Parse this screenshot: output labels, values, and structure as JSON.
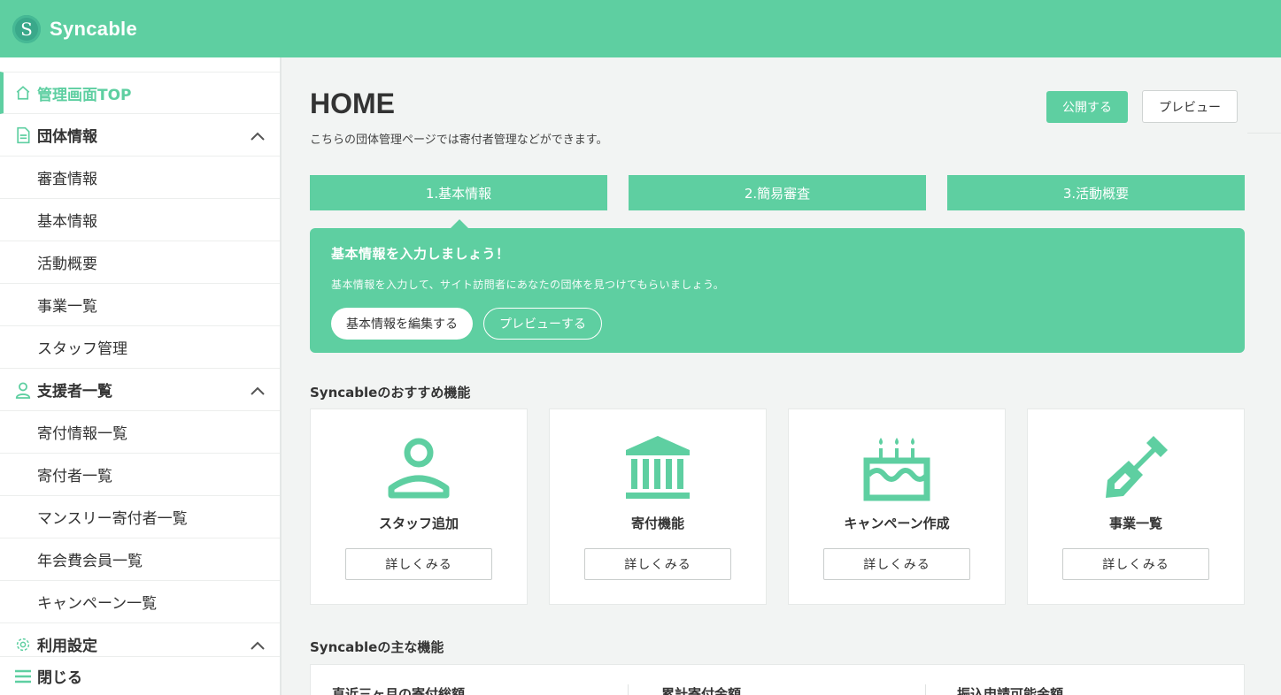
{
  "header": {
    "logo_glyph": "S",
    "app_name": "Syncable"
  },
  "sidebar": {
    "top_item": "管理画面TOP",
    "groups": [
      {
        "label": "団体情報",
        "icon": "document-icon",
        "items": [
          "審査情報",
          "基本情報",
          "活動概要",
          "事業一覧",
          "スタッフ管理"
        ]
      },
      {
        "label": "支援者一覧",
        "icon": "person-icon",
        "items": [
          "寄付情報一覧",
          "寄付者一覧",
          "マンスリー寄付者一覧",
          "年会費会員一覧",
          "キャンペーン一覧"
        ]
      },
      {
        "label": "利用設定",
        "icon": "gear-icon",
        "items": []
      }
    ],
    "close_label": "閉じる"
  },
  "main": {
    "title": "HOME",
    "description": "こちらの団体管理ページでは寄付者管理などができます。",
    "publish_label": "公開する",
    "preview_label": "プレビュー",
    "steps": [
      "1.基本情報",
      "2.簡易審査",
      "3.活動概要"
    ],
    "banner": {
      "title": "基本情報を入力しましょう！",
      "text": "基本情報を入力して、サイト訪問者にあなたの団体を見つけてもらいましょう。",
      "edit_label": "基本情報を編集する",
      "preview_label": "プレビューする"
    },
    "recommended_title": "Syncableのおすすめ機能",
    "cards": [
      {
        "label": "スタッフ追加",
        "button": "詳しくみる",
        "icon": "staff-icon"
      },
      {
        "label": "寄付機能",
        "button": "詳しくみる",
        "icon": "bank-icon"
      },
      {
        "label": "キャンペーン作成",
        "button": "詳しくみる",
        "icon": "cake-icon"
      },
      {
        "label": "事業一覧",
        "button": "詳しくみる",
        "icon": "shovel-icon"
      }
    ],
    "main_features_title": "Syncableの主な機能",
    "stats": [
      "直近三ヶ月の寄付総額",
      "累計寄付金額",
      "振込申請可能金額"
    ]
  },
  "colors": {
    "accent": "#5ecfa1",
    "background": "#f2f4f3"
  }
}
